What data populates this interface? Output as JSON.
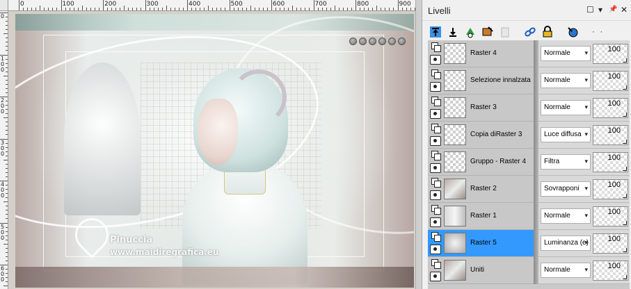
{
  "canvas": {
    "ruler_top_labels": [
      "0",
      "100",
      "200",
      "300",
      "400",
      "500",
      "600",
      "700",
      "800",
      "900"
    ],
    "ruler_left_labels": [
      "0",
      "100",
      "200",
      "300",
      "400",
      "500",
      "600"
    ],
    "watermark": {
      "line1": "Pinuccia",
      "line2": "www.maidiregrafica.eu"
    }
  },
  "panel": {
    "title": "Livelli",
    "controls": {
      "maximize": "☐",
      "menu": "▾",
      "pin": "📌",
      "close": "✕"
    },
    "toolbar": {
      "more": "· ·"
    },
    "layers": [
      {
        "name": "Raster 4",
        "blend": "Normale",
        "opacity": "100",
        "selected": false,
        "thumb": "transparent"
      },
      {
        "name": "Selezione innalzata",
        "blend": "Normale",
        "opacity": "100",
        "selected": false,
        "thumb": "transparent"
      },
      {
        "name": "Raster 3",
        "blend": "Normale",
        "opacity": "100",
        "selected": false,
        "thumb": "transparent"
      },
      {
        "name": "Copia diRaster 3",
        "blend": "Luce diffusa",
        "opacity": "100",
        "selected": false,
        "thumb": "transparent"
      },
      {
        "name": "Gruppo - Raster 4",
        "blend": "Filtra",
        "opacity": "100",
        "selected": false,
        "thumb": "transparent"
      },
      {
        "name": "Raster 2",
        "blend": "Sovrapponi",
        "opacity": "100",
        "selected": false,
        "thumb": "img"
      },
      {
        "name": "Raster 1",
        "blend": "Normale",
        "opacity": "100",
        "selected": false,
        "thumb": "img3"
      },
      {
        "name": "Raster 5",
        "blend": "Luminanza (e)",
        "opacity": "100",
        "selected": true,
        "thumb": "img2"
      },
      {
        "name": "Uniti",
        "blend": "Normale",
        "opacity": "100",
        "selected": false,
        "thumb": "img"
      }
    ]
  }
}
